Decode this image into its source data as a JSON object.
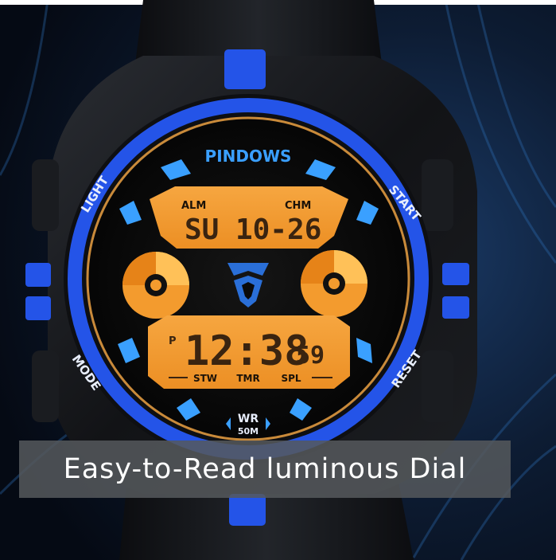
{
  "photo": {
    "brand": "PINDOWS",
    "lcd_top": {
      "left_label": "ALM",
      "right_label": "CHM",
      "day": "SU",
      "date": "10-26"
    },
    "lcd_bottom": {
      "pm_indicator": "P",
      "time": "12:38",
      "seconds": "59",
      "mode_labels": [
        "STW",
        "TMR",
        "SPL"
      ]
    },
    "bezel_labels": {
      "light": "LIGHT",
      "start": "START",
      "mode": "MODE",
      "reset": "RESET"
    },
    "water_resistance": {
      "line1": "WR",
      "line2": "50M"
    },
    "colors": {
      "accent_blue": "#2454e8",
      "lcd_orange": "#f39b2e",
      "segment_dark": "#3a2410",
      "background": "#0a1220"
    }
  },
  "caption": "Easy-to-Read luminous Dial"
}
